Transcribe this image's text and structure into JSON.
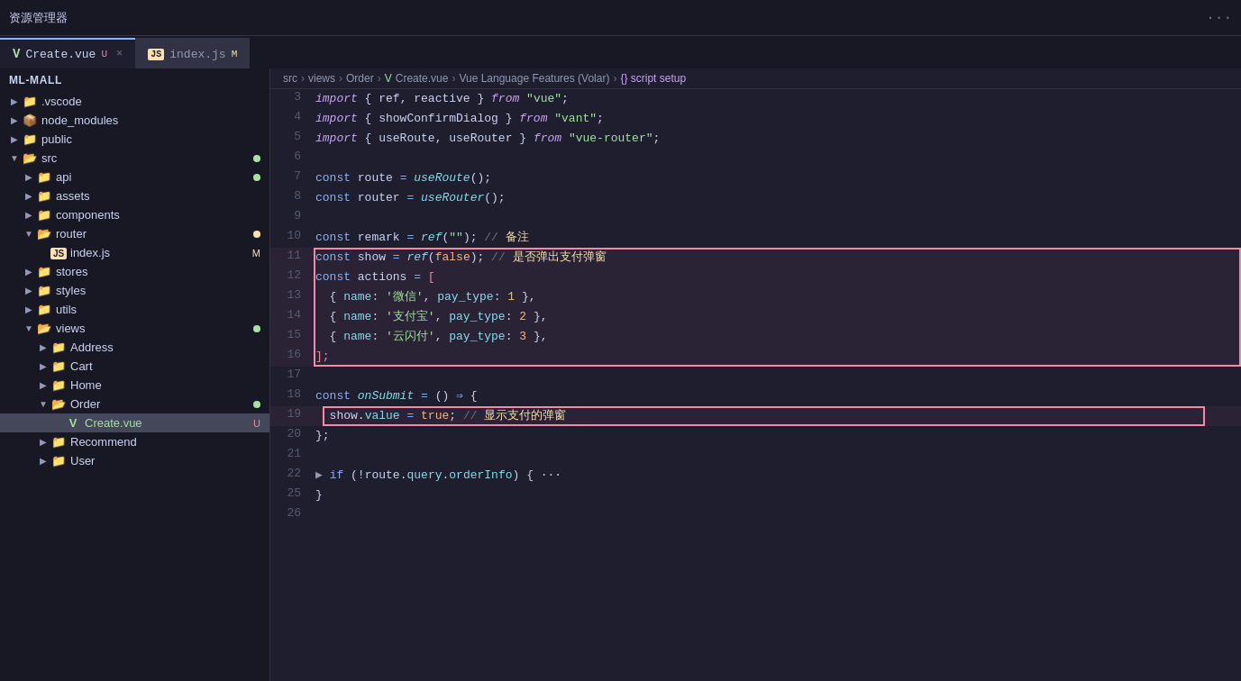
{
  "topbar": {
    "title": "资源管理器",
    "dots": "···"
  },
  "tabs": [
    {
      "id": "create-vue",
      "icon_type": "vue",
      "icon_label": "V",
      "label": "Create.vue",
      "badge": "U",
      "badge_type": "unsaved",
      "active": true
    },
    {
      "id": "index-js",
      "icon_type": "js",
      "icon_label": "JS",
      "label": "index.js",
      "badge": "M",
      "badge_type": "modified",
      "active": false
    }
  ],
  "breadcrumb": {
    "path": "src > views > Order > Create.vue > Vue Language Features (Volar) > {} script setup"
  },
  "sidebar": {
    "section_title": "ML-MALL",
    "items": [
      {
        "id": "vscode",
        "indent": 1,
        "label": ".vscode",
        "type": "folder",
        "chevron": "▶",
        "badge": null
      },
      {
        "id": "node_modules",
        "indent": 1,
        "label": "node_modules",
        "type": "folder-node",
        "chevron": "▶",
        "badge": null
      },
      {
        "id": "public",
        "indent": 1,
        "label": "public",
        "type": "folder",
        "chevron": "▶",
        "badge": null
      },
      {
        "id": "src",
        "indent": 1,
        "label": "src",
        "type": "folder-open",
        "chevron": "▼",
        "badge": "green"
      },
      {
        "id": "api",
        "indent": 2,
        "label": "api",
        "type": "folder",
        "chevron": "▶",
        "badge": "green"
      },
      {
        "id": "assets",
        "indent": 2,
        "label": "assets",
        "type": "folder",
        "chevron": "▶",
        "badge": null
      },
      {
        "id": "components",
        "indent": 2,
        "label": "components",
        "type": "folder",
        "chevron": "▶",
        "badge": null
      },
      {
        "id": "router",
        "indent": 2,
        "label": "router",
        "type": "folder-open",
        "chevron": "▼",
        "badge": "yellow"
      },
      {
        "id": "index-js-sidebar",
        "indent": 3,
        "label": "index.js",
        "type": "js",
        "chevron": "",
        "badge": "M"
      },
      {
        "id": "stores",
        "indent": 2,
        "label": "stores",
        "type": "folder",
        "chevron": "▶",
        "badge": null
      },
      {
        "id": "styles",
        "indent": 2,
        "label": "styles",
        "type": "folder",
        "chevron": "▶",
        "badge": null
      },
      {
        "id": "utils",
        "indent": 2,
        "label": "utils",
        "type": "folder",
        "chevron": "▶",
        "badge": null
      },
      {
        "id": "views",
        "indent": 2,
        "label": "views",
        "type": "folder-open",
        "chevron": "▼",
        "badge": "green"
      },
      {
        "id": "address",
        "indent": 3,
        "label": "Address",
        "type": "folder",
        "chevron": "▶",
        "badge": null
      },
      {
        "id": "cart",
        "indent": 3,
        "label": "Cart",
        "type": "folder",
        "chevron": "▶",
        "badge": null
      },
      {
        "id": "home",
        "indent": 3,
        "label": "Home",
        "type": "folder",
        "chevron": "▶",
        "badge": null
      },
      {
        "id": "order",
        "indent": 3,
        "label": "Order",
        "type": "folder-open",
        "chevron": "▼",
        "badge": "green"
      },
      {
        "id": "create-vue-sidebar",
        "indent": 4,
        "label": "Create.vue",
        "type": "vue",
        "chevron": "",
        "badge": "U",
        "active": true
      },
      {
        "id": "recommend",
        "indent": 3,
        "label": "Recommend",
        "type": "folder",
        "chevron": "▶",
        "badge": null
      },
      {
        "id": "user",
        "indent": 3,
        "label": "User",
        "type": "folder",
        "chevron": "▶",
        "badge": null
      }
    ]
  },
  "code_lines": [
    {
      "num": 3,
      "tokens": [
        {
          "t": "import-kw",
          "v": "import"
        },
        {
          "t": "punc",
          "v": " { "
        },
        {
          "t": "var",
          "v": "ref"
        },
        {
          "t": "punc",
          "v": ", "
        },
        {
          "t": "var",
          "v": "reactive"
        },
        {
          "t": "punc",
          "v": " } "
        },
        {
          "t": "import-kw",
          "v": "from"
        },
        {
          "t": "str",
          "v": " \"vue\""
        },
        {
          "t": "punc",
          "v": ";"
        }
      ]
    },
    {
      "num": 4,
      "tokens": [
        {
          "t": "import-kw",
          "v": "import"
        },
        {
          "t": "punc",
          "v": " { "
        },
        {
          "t": "var",
          "v": "showConfirmDialog"
        },
        {
          "t": "punc",
          "v": " } "
        },
        {
          "t": "import-kw",
          "v": "from"
        },
        {
          "t": "str",
          "v": " \"vant\""
        },
        {
          "t": "punc",
          "v": ";"
        }
      ]
    },
    {
      "num": 5,
      "tokens": [
        {
          "t": "import-kw",
          "v": "import"
        },
        {
          "t": "punc",
          "v": " { "
        },
        {
          "t": "var",
          "v": "useRoute"
        },
        {
          "t": "punc",
          "v": ", "
        },
        {
          "t": "var",
          "v": "useRouter"
        },
        {
          "t": "punc",
          "v": " } "
        },
        {
          "t": "import-kw",
          "v": "from"
        },
        {
          "t": "str",
          "v": " \"vue-router\""
        },
        {
          "t": "punc",
          "v": ";"
        }
      ]
    },
    {
      "num": 6,
      "tokens": []
    },
    {
      "num": 7,
      "tokens": [
        {
          "t": "kw",
          "v": "const"
        },
        {
          "t": "var",
          "v": " route "
        },
        {
          "t": "op",
          "v": "="
        },
        {
          "t": "fn",
          "v": " useRoute"
        },
        {
          "t": "punc",
          "v": "();"
        }
      ]
    },
    {
      "num": 8,
      "tokens": [
        {
          "t": "kw",
          "v": "const"
        },
        {
          "t": "var",
          "v": " router "
        },
        {
          "t": "op",
          "v": "="
        },
        {
          "t": "fn",
          "v": " useRouter"
        },
        {
          "t": "punc",
          "v": "();"
        }
      ]
    },
    {
      "num": 9,
      "tokens": []
    },
    {
      "num": 10,
      "tokens": [
        {
          "t": "kw",
          "v": "const"
        },
        {
          "t": "var",
          "v": " remark "
        },
        {
          "t": "op",
          "v": "="
        },
        {
          "t": "fn",
          "v": " ref"
        },
        {
          "t": "punc",
          "v": "("
        },
        {
          "t": "str",
          "v": "\"\""
        },
        {
          "t": "punc",
          "v": "); "
        },
        {
          "t": "comment",
          "v": "// "
        },
        {
          "t": "comment-zh",
          "v": "备注"
        }
      ],
      "red_start": false
    },
    {
      "num": 11,
      "tokens": [
        {
          "t": "kw",
          "v": "const"
        },
        {
          "t": "var",
          "v": " show "
        },
        {
          "t": "op",
          "v": "="
        },
        {
          "t": "fn",
          "v": " ref"
        },
        {
          "t": "punc",
          "v": "("
        },
        {
          "t": "val-false",
          "v": "false"
        },
        {
          "t": "punc",
          "v": "); "
        },
        {
          "t": "comment",
          "v": "// "
        },
        {
          "t": "comment-zh",
          "v": "是否弹出支付弹窗"
        }
      ],
      "red_box": true
    },
    {
      "num": 12,
      "tokens": [
        {
          "t": "kw",
          "v": "const"
        },
        {
          "t": "var",
          "v": " actions "
        },
        {
          "t": "op",
          "v": "="
        },
        {
          "t": "arr-brace",
          "v": " ["
        }
      ],
      "red_box": true
    },
    {
      "num": 13,
      "tokens": [
        {
          "t": "punc",
          "v": "  { "
        },
        {
          "t": "obj-key",
          "v": "name"
        },
        {
          "t": "punc",
          "v": ": "
        },
        {
          "t": "str",
          "v": "'微信'"
        },
        {
          "t": "punc",
          "v": ", "
        },
        {
          "t": "obj-key",
          "v": "pay_type"
        },
        {
          "t": "punc",
          "v": ": "
        },
        {
          "t": "num",
          "v": "1"
        },
        {
          "t": "punc",
          "v": " },"
        }
      ],
      "red_box": true
    },
    {
      "num": 14,
      "tokens": [
        {
          "t": "punc",
          "v": "  { "
        },
        {
          "t": "obj-key",
          "v": "name"
        },
        {
          "t": "punc",
          "v": ": "
        },
        {
          "t": "str",
          "v": "'支付宝'"
        },
        {
          "t": "punc",
          "v": ", "
        },
        {
          "t": "obj-key",
          "v": "pay_type"
        },
        {
          "t": "punc",
          "v": ": "
        },
        {
          "t": "num",
          "v": "2"
        },
        {
          "t": "punc",
          "v": " },"
        }
      ],
      "red_box": true
    },
    {
      "num": 15,
      "tokens": [
        {
          "t": "punc",
          "v": "  { "
        },
        {
          "t": "obj-key",
          "v": "name"
        },
        {
          "t": "punc",
          "v": ": "
        },
        {
          "t": "str",
          "v": "'云闪付'"
        },
        {
          "t": "punc",
          "v": ", "
        },
        {
          "t": "obj-key",
          "v": "pay_type"
        },
        {
          "t": "punc",
          "v": ": "
        },
        {
          "t": "num",
          "v": "3"
        },
        {
          "t": "punc",
          "v": " },"
        }
      ],
      "red_box": true
    },
    {
      "num": 16,
      "tokens": [
        {
          "t": "arr-brace",
          "v": "];"
        }
      ],
      "red_box": true
    },
    {
      "num": 17,
      "tokens": []
    },
    {
      "num": 18,
      "tokens": [
        {
          "t": "kw",
          "v": "const"
        },
        {
          "t": "fn",
          "v": " onSubmit "
        },
        {
          "t": "op",
          "v": "="
        },
        {
          "t": "punc",
          "v": " () "
        },
        {
          "t": "arrow",
          "v": "⇒"
        },
        {
          "t": "punc",
          "v": " {"
        }
      ]
    },
    {
      "num": 19,
      "tokens": [
        {
          "t": "var",
          "v": "  show"
        },
        {
          "t": "punc",
          "v": "."
        },
        {
          "t": "prop",
          "v": "value"
        },
        {
          "t": "op",
          "v": " = "
        },
        {
          "t": "val-false",
          "v": "true"
        },
        {
          "t": "punc",
          "v": "; "
        },
        {
          "t": "comment",
          "v": "// "
        },
        {
          "t": "comment-zh",
          "v": "显示支付的弹窗"
        }
      ],
      "red_box_small": true
    },
    {
      "num": 20,
      "tokens": [
        {
          "t": "punc",
          "v": "};"
        }
      ]
    },
    {
      "num": 21,
      "tokens": []
    },
    {
      "num": 22,
      "tokens": [
        {
          "t": "collapse-arrow",
          "v": "▶ "
        },
        {
          "t": "kw",
          "v": "if"
        },
        {
          "t": "punc",
          "v": " (!"
        },
        {
          "t": "var",
          "v": "route"
        },
        {
          "t": "punc",
          "v": "."
        },
        {
          "t": "prop",
          "v": "query"
        },
        {
          "t": "punc",
          "v": "."
        },
        {
          "t": "prop",
          "v": "orderInfo"
        },
        {
          "t": "punc",
          "v": ") { ···"
        }
      ]
    },
    {
      "num": 25,
      "tokens": [
        {
          "t": "punc",
          "v": "}"
        }
      ]
    },
    {
      "num": 26,
      "tokens": []
    }
  ]
}
